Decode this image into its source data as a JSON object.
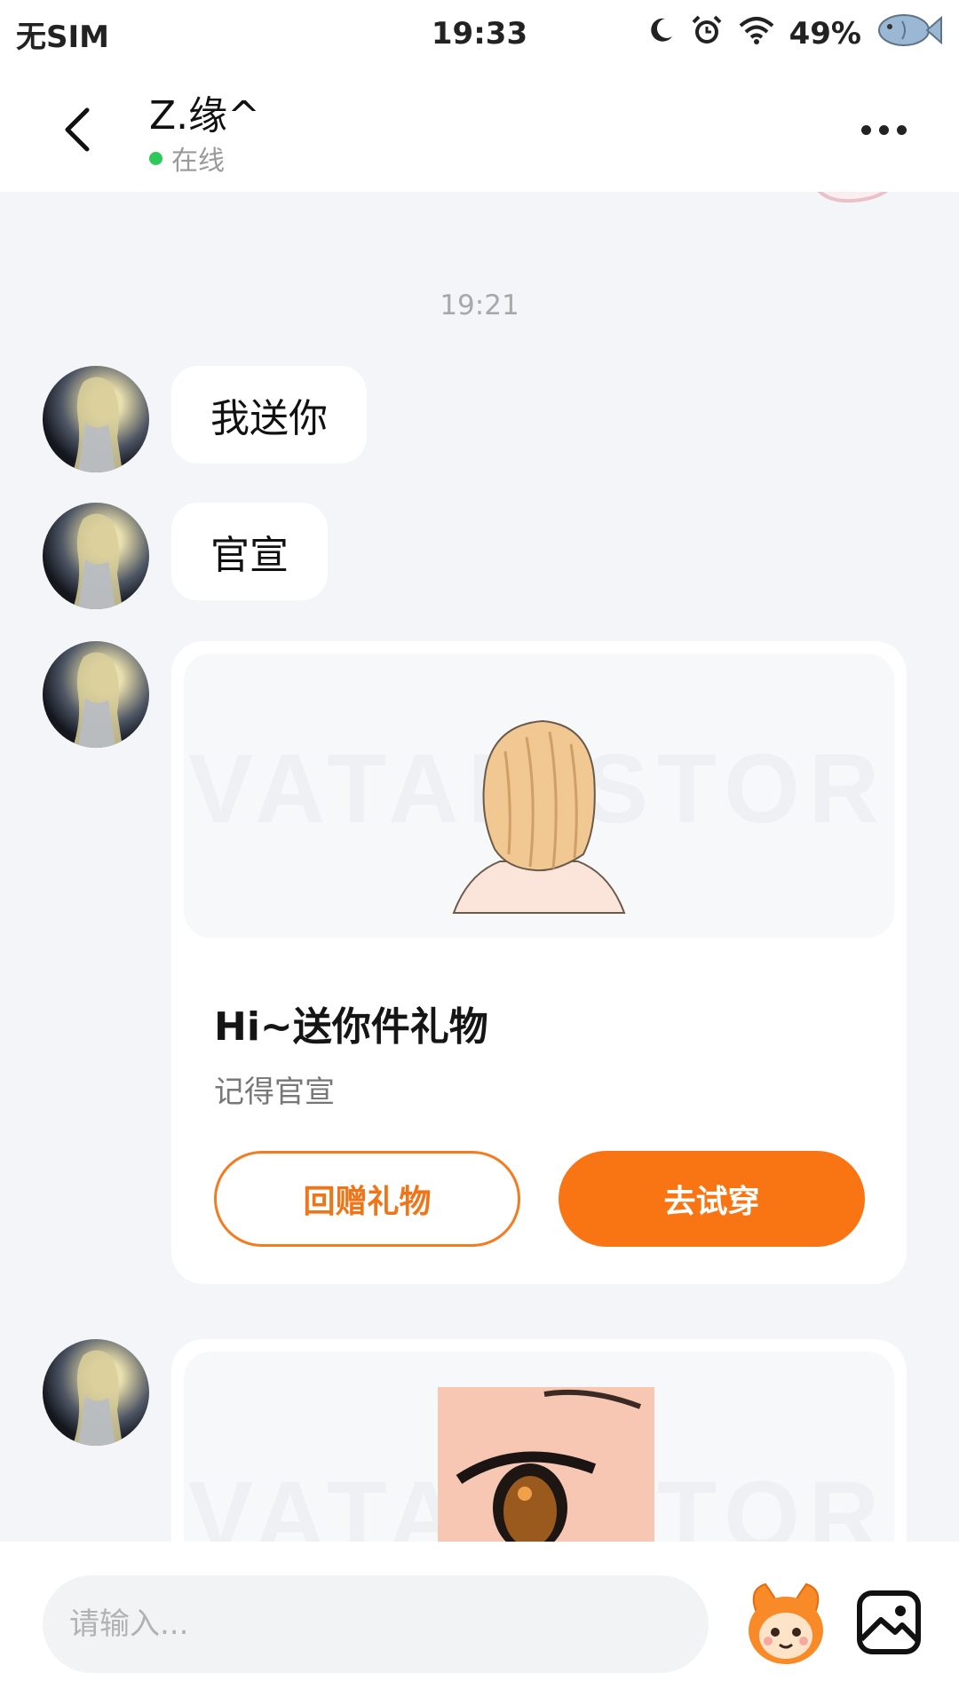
{
  "status_bar": {
    "carrier": "无SIM",
    "time": "19:33",
    "battery": "49%",
    "icons": [
      "moon-icon",
      "alarm-icon",
      "wifi-icon",
      "fish-icon"
    ]
  },
  "header": {
    "back_icon": "chevron-left-icon",
    "contact_name": "Z.缘^",
    "status": "在线",
    "more_icon": "more-horizontal-icon"
  },
  "chat": {
    "time_label": "19:21",
    "messages": [
      {
        "type": "text",
        "text": "我送你"
      },
      {
        "type": "text",
        "text": "官宣"
      },
      {
        "type": "gift-card",
        "watermark": "AVATAR STORE",
        "title": "Hi~送你件礼物",
        "description": "记得官宣",
        "secondary_button": "回赠礼物",
        "primary_button": "去试穿"
      },
      {
        "type": "gift-card-partial",
        "watermark": "AVATAR STORE"
      }
    ]
  },
  "input_bar": {
    "placeholder": "请输入...",
    "icons": [
      "mascot-icon",
      "image-icon"
    ]
  },
  "colors": {
    "accent": "#f97514",
    "online": "#2fc85a",
    "chat_background": "#f3f5f8"
  }
}
